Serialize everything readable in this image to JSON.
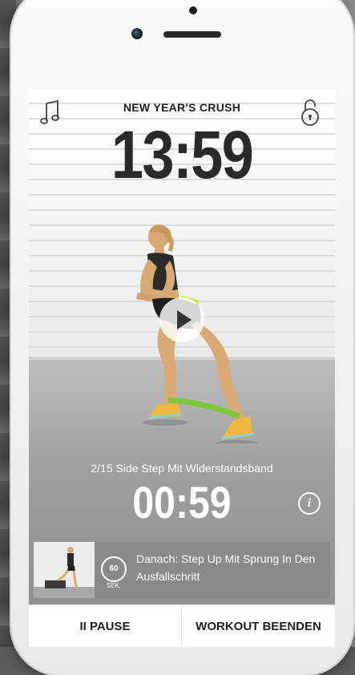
{
  "workout": {
    "title": "NEW YEAR'S CRUSH",
    "total_timer": "13:59"
  },
  "icons": {
    "music": "music-note-icon",
    "lock": "lock-open-icon",
    "play": "play-icon",
    "info": "info-icon"
  },
  "exercise": {
    "label": "2/15 Side Step Mit Widerstandsband",
    "timer": "00:59",
    "info_label": "i"
  },
  "next": {
    "rest_seconds": "60",
    "rest_unit": "SEK.",
    "text": "Danach: Step Up Mit Sprung In Den Ausfallschritt"
  },
  "controls": {
    "pause_label": "II PAUSE",
    "end_label": "WORKOUT BEENDEN"
  },
  "colors": {
    "band": "#7ec83a",
    "shoes": "#f0b83c"
  }
}
